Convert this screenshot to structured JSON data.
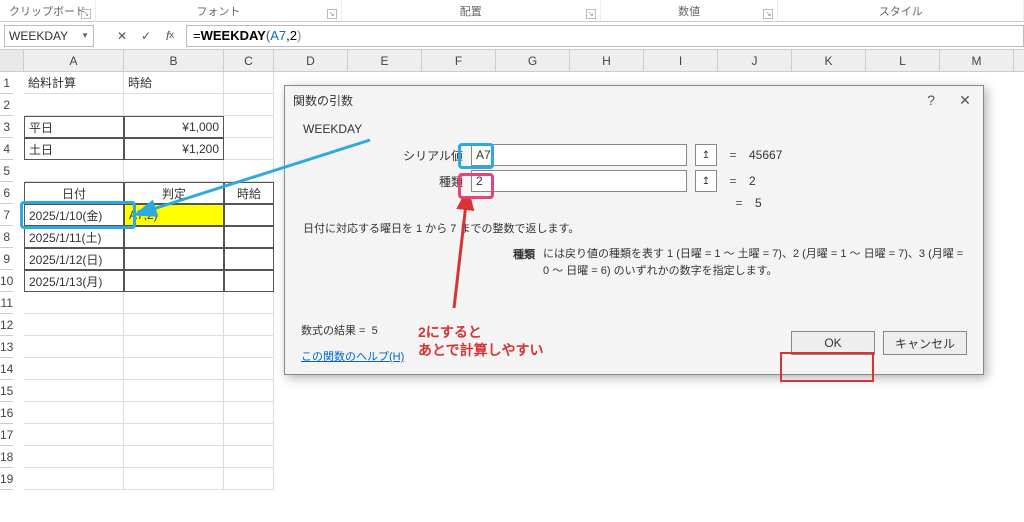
{
  "ribbon": {
    "groups": [
      "クリップボード",
      "フォント",
      "配置",
      "数値",
      "スタイル"
    ]
  },
  "namebox": "WEEKDAY",
  "formula": {
    "raw": "=WEEKDAY(A7,2)",
    "eq": "=",
    "fn": "WEEKDAY",
    "open": "(",
    "arg1": "A7",
    "comma": ",2",
    "close": ")"
  },
  "columns": [
    "A",
    "B",
    "C",
    "D",
    "E",
    "F",
    "G",
    "H",
    "I",
    "J",
    "K",
    "L",
    "M"
  ],
  "rows": [
    "1",
    "2",
    "3",
    "4",
    "5",
    "6",
    "7",
    "8",
    "9",
    "10",
    "11",
    "12",
    "13",
    "14",
    "15",
    "16",
    "17",
    "18",
    "19"
  ],
  "cells": {
    "a1": "給料計算",
    "b1": "時給",
    "a3": "平日",
    "b3": "¥1,000",
    "a4": "土日",
    "b4": "¥1,200",
    "a6": "日付",
    "b6": "判定",
    "c6": "時給",
    "a7": "2025/1/10(金)",
    "b7": "A7,2)",
    "a8": "2025/1/11(土)",
    "a9": "2025/1/12(日)",
    "a10": "2025/1/13(月)"
  },
  "dialog": {
    "title": "関数の引数",
    "fn": "WEEKDAY",
    "arg1_label": "シリアル値",
    "arg1_val": "A7",
    "arg1_res": "45667",
    "arg2_label": "種類",
    "arg2_val": "2",
    "arg2_res": "2",
    "final_res": "5",
    "desc1": "日付に対応する曜日を 1 から 7 までの整数で返します。",
    "desc2_label": "種類",
    "desc2_text": "には戻り値の種類を表す 1 (日曜 = 1 ～ 土曜 = 7)、2 (月曜 = 1 ～ 日曜 = 7)、3 (月曜 = 0 ～ 日曜 = 6) のいずれかの数字を指定します。",
    "result_label": "数式の結果 =",
    "result_val": "5",
    "help": "この関数のヘルプ(H)",
    "ok": "OK",
    "cancel": "キャンセル",
    "help_q": "?",
    "close_x": "✕"
  },
  "annotations": {
    "red1": "2にすると",
    "red2": "あとで計算しやすい"
  }
}
